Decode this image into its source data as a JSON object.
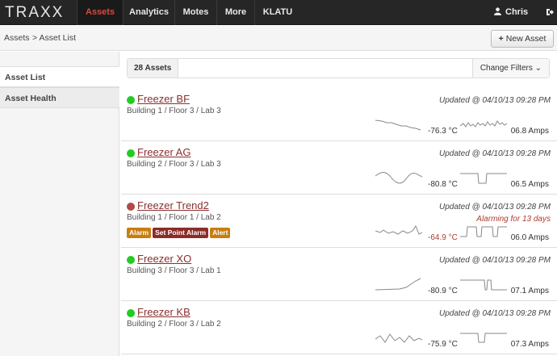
{
  "nav": {
    "brand": "TRAXX",
    "items": [
      {
        "label": "Assets",
        "active": true
      },
      {
        "label": "Analytics"
      },
      {
        "label": "Motes"
      },
      {
        "label": "More"
      },
      {
        "label": "KLATU"
      }
    ],
    "user": "Chris"
  },
  "breadcrumb": {
    "root": "Assets",
    "current": "> Asset List"
  },
  "new_asset_label": "New Asset",
  "sidebar": {
    "items": [
      {
        "label": "Asset List",
        "active": true
      },
      {
        "label": "Asset Health"
      }
    ]
  },
  "header": {
    "count": "28 Assets",
    "filters": "Change Filters ⌄"
  },
  "assets": [
    {
      "name": "Freezer BF",
      "status": "green",
      "location": "Building 1 / Floor 3 / Lab 3",
      "updated": "Updated @ 04/10/13 09:28 PM",
      "temp": "-76.3 °C",
      "amps": "06.8 Amps",
      "temp_alarm": false
    },
    {
      "name": "Freezer AG",
      "status": "green",
      "location": "Building 2 / Floor 3 / Lab 3",
      "updated": "Updated @ 04/10/13 09:28 PM",
      "temp": "-80.8 °C",
      "amps": "06.5 Amps",
      "temp_alarm": false
    },
    {
      "name": "Freezer Trend2",
      "status": "red",
      "location": "Building 1 / Floor 1 / Lab 2",
      "updated": "Updated @ 04/10/13 09:28 PM",
      "alarming": "Alarming for 13 days",
      "badges": [
        "Alarm",
        "Set Point Alarm",
        "Alert"
      ],
      "temp": "-64.9 °C",
      "amps": "06.0 Amps",
      "temp_alarm": true
    },
    {
      "name": "Freezer XO",
      "status": "green",
      "location": "Building 3 / Floor 3 / Lab 1",
      "updated": "Updated @ 04/10/13 09:28 PM",
      "temp": "-80.9 °C",
      "amps": "07.1 Amps",
      "temp_alarm": false
    },
    {
      "name": "Freezer KB",
      "status": "green",
      "location": "Building 2 / Floor 3 / Lab 2",
      "updated": "Updated @ 04/10/13 09:28 PM",
      "temp": "-75.9 °C",
      "amps": "07.3 Amps",
      "temp_alarm": false
    }
  ],
  "colors": {
    "accent": "#d84a3c",
    "ok": "#22cc22",
    "alarm": "#b24a45",
    "badge_orange": "#c87d12",
    "badge_darkred": "#8c2c29"
  }
}
